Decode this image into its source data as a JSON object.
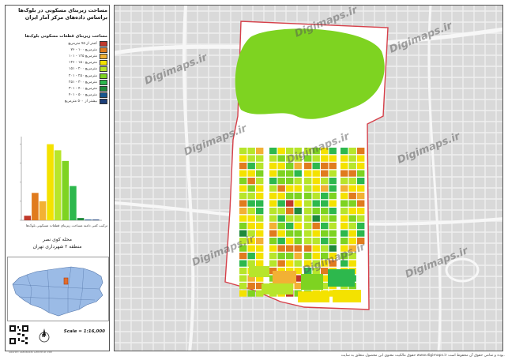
{
  "map": {
    "title_lines": [
      "مساحت زیربنای مسکونی در بلوک‌ها",
      "براساس داده‌های مرکز آمار ایران"
    ],
    "legend_title": "مساحت زیربنای قطعات مسکونی بلوک‌ها",
    "legend_items": [
      {
        "label": "کمتر از ۷۵ مترمربع",
        "color": "#c0392b"
      },
      {
        "label": "۷۶ - ۱۰۰ مترمربع",
        "color": "#e07b1e"
      },
      {
        "label": "۱۰۱ - ۱۲۵ مترمربع",
        "color": "#f2b134"
      },
      {
        "label": "۱۲۶ - ۱۵۰ مترمربع",
        "color": "#f4e200"
      },
      {
        "label": "۱۵۱ - ۲۰۰ مترمربع",
        "color": "#b7e52b"
      },
      {
        "label": "۲۰۱ - ۲۵۰ مترمربع",
        "color": "#7ed321"
      },
      {
        "label": "۲۵۱ - ۳۰۰ مترمربع",
        "color": "#2db84d"
      },
      {
        "label": "۳۰۱ - ۴۰۰ مترمربع",
        "color": "#1f8a3b"
      },
      {
        "label": "۴۰۱ - ۵۰۰ مترمربع",
        "color": "#18578e"
      },
      {
        "label": "بیشتر از ۵۰۰ مترمربع",
        "color": "#1c3f7a"
      }
    ],
    "histogram_caption": "ترکیب کمی دامنه مساحت زیربنای قطعات مسکونی بلوک‌ها",
    "location_title": [
      "محله کوی نصر",
      "منطقه ۲ شهرداری تهران"
    ],
    "scale": "Scale = 1:16,000",
    "north_label": "N",
    "footer": "حقوق مالکیت معنوی این محصول متعلق به سایت www.digimaps.ir بوده و تمامی حقوق آن محفوظ است.",
    "credit": "Source: Statistical Centre of Iran",
    "watermark": "Digimaps.ir"
  },
  "chart_data": {
    "type": "bar",
    "categories": [
      "<75",
      "76-100",
      "101-125",
      "126-150",
      "151-200",
      "201-250",
      "251-300",
      "301-400",
      "401-500",
      ">500"
    ],
    "values": [
      6,
      36,
      25,
      100,
      92,
      78,
      45,
      3,
      1,
      1
    ],
    "colors": [
      "#c0392b",
      "#e07b1e",
      "#f2b134",
      "#f4e200",
      "#b7e52b",
      "#7ed321",
      "#2db84d",
      "#1f8a3b",
      "#18578e",
      "#1c3f7a"
    ],
    "ylim": [
      0,
      110
    ],
    "title": "",
    "xlabel": "",
    "ylabel": ""
  }
}
